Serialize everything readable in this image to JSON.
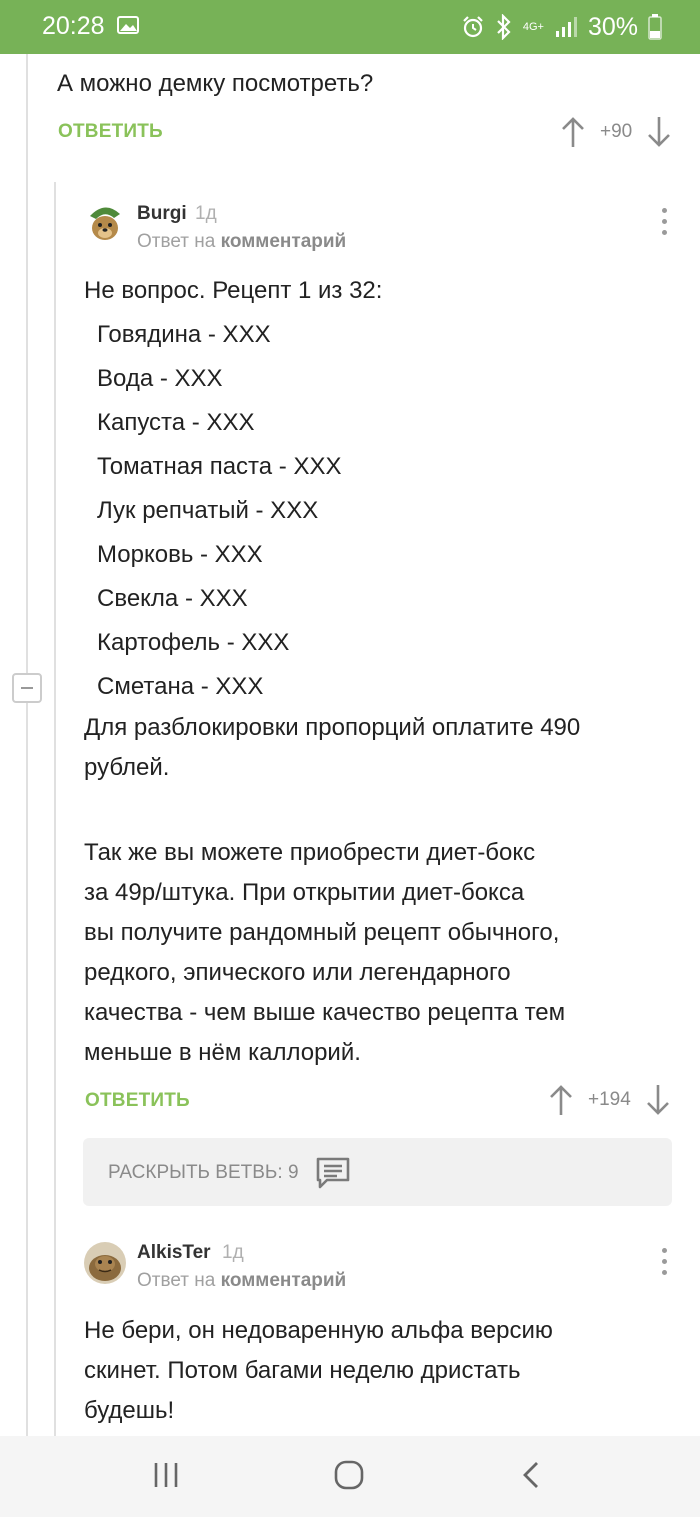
{
  "status_bar": {
    "time": "20:28",
    "battery": "30%",
    "network": "4G+",
    "icons": [
      "image-icon",
      "alarm-icon",
      "bluetooth-icon",
      "signal-icon",
      "battery-icon"
    ]
  },
  "comment_parent": {
    "text": "А можно демку посмотреть?",
    "reply_label": "ОТВЕТИТЬ",
    "score": "+90"
  },
  "comment_burgi": {
    "author": "Burgi",
    "age": "1д",
    "reply_prefix": "Ответ на",
    "reply_target": "комментарий",
    "intro": "Не вопрос. Рецепт 1 из 32:",
    "ingredients": [
      "Говядина - ХХХ",
      "Вода - ХХХ",
      "Капуста - ХХХ",
      "Томатная паста - ХХХ",
      "Лук репчатый - ХХХ",
      "Морковь - ХХХ",
      "Свекла - ХХХ",
      "Картофель - ХХХ",
      "Сметана - ХХХ"
    ],
    "unlock_line1": "Для разблокировки пропорций оплатите 490",
    "unlock_line2": "рублей.",
    "box_lines": [
      "Так же вы можете приобрести диет-бокс",
      "за 49р/штука. При открытии диет-бокса",
      "вы получите рандомный рецепт обычного,",
      "редкого, эпического или легендарного",
      "качества - чем выше качество рецепта тем",
      "меньше в нём каллорий."
    ],
    "reply_label": "ОТВЕТИТЬ",
    "score": "+194"
  },
  "expand_branch": {
    "label": "РАСКРЫТЬ ВЕТВЬ: 9"
  },
  "comment_alkister": {
    "author": "AlkisTer",
    "age": "1д",
    "reply_prefix": "Ответ на",
    "reply_target": "комментарий",
    "lines": [
      "Не бери, он недоваренную альфа версию",
      "скинет. Потом багами неделю дристать",
      "будешь!"
    ]
  },
  "colors": {
    "status_bar": "#77b257",
    "accent_green": "#8ac25a",
    "muted": "#8a8a8a"
  }
}
